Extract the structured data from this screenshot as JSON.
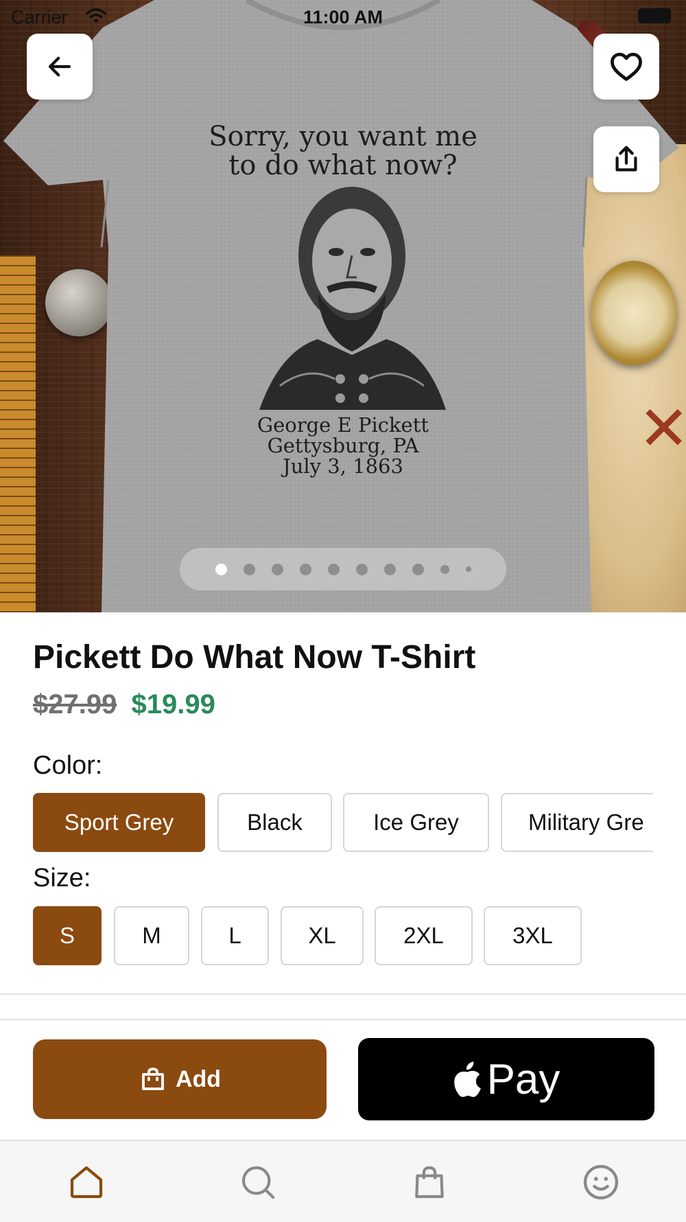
{
  "status_bar": {
    "carrier": "Carrier",
    "time": "11:00 AM"
  },
  "hero": {
    "shirt_print_headline": [
      "Sorry, you want me",
      "to do what now?"
    ],
    "shirt_print_caption": [
      "George E Pickett",
      "Gettysburg, PA",
      "July 3, 1863"
    ],
    "page_indicator": {
      "total": 10,
      "current": 1
    },
    "icons": {
      "back": "arrow-left-icon",
      "favorite": "heart-icon",
      "share": "share-icon"
    }
  },
  "product": {
    "title": "Pickett Do What Now T-Shirt",
    "original_price": "$27.99",
    "sale_price": "$19.99"
  },
  "options": {
    "color_label": "Color:",
    "colors": [
      "Sport Grey",
      "Black",
      "Ice Grey",
      "Military Gre"
    ],
    "selected_color": "Sport Grey",
    "size_label": "Size:",
    "sizes": [
      "S",
      "M",
      "L",
      "XL",
      "2XL",
      "3XL"
    ],
    "selected_size": "S"
  },
  "actions": {
    "add_label": "Add",
    "add_icon": "shopping-bag-icon",
    "apple_pay_label": "Pay",
    "apple_pay_icon": "apple-logo-icon"
  },
  "tab_bar": {
    "items": [
      {
        "icon": "home-icon",
        "active": true
      },
      {
        "icon": "search-icon",
        "active": false
      },
      {
        "icon": "shopping-bag-icon",
        "active": false
      },
      {
        "icon": "smiley-account-icon",
        "active": false
      }
    ]
  },
  "colors": {
    "accent": "#8B4A10",
    "sale_price": "#2A8A5A",
    "original_price": "#707070",
    "apple_pay_bg": "#000000"
  }
}
